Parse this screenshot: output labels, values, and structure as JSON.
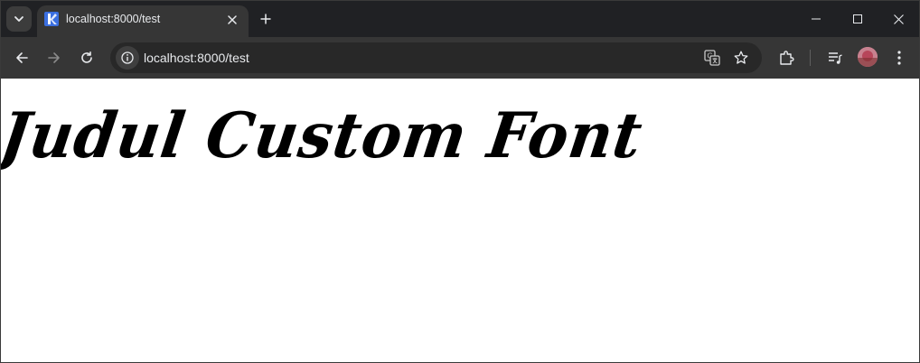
{
  "tab": {
    "title": "localhost:8000/test"
  },
  "omnibox": {
    "url": "localhost:8000/test"
  },
  "page": {
    "heading": "Judul Custom Font"
  },
  "colors": {
    "tab_active": "#363636",
    "tabstrip": "#202124",
    "toolbar": "#363636",
    "omnibox": "#282828",
    "favicon": "#3b6fe0"
  },
  "icons": [
    "tab-search-icon",
    "favicon-icon",
    "tab-close-icon",
    "new-tab-icon",
    "minimize-icon",
    "maximize-icon",
    "window-close-icon",
    "back-icon",
    "forward-icon",
    "reload-icon",
    "site-info-icon",
    "translate-icon",
    "bookmark-star-icon",
    "extensions-icon",
    "media-control-icon",
    "kebab-menu-icon"
  ]
}
